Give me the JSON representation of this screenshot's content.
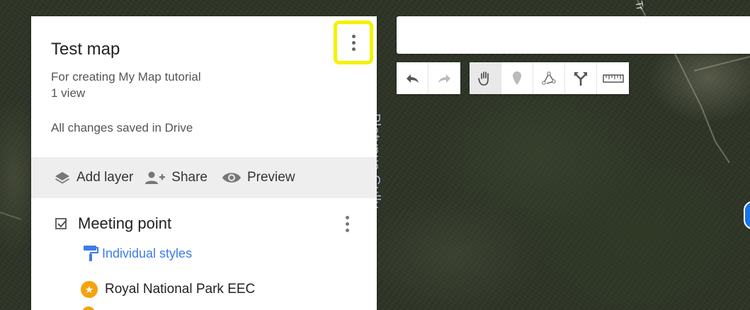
{
  "map": {
    "gully_label": "Platypus Gully",
    "corner_label": "Tr"
  },
  "panel": {
    "title": "Test map",
    "description": "For creating My Map tutorial",
    "views": "1 view",
    "save_status": "All changes saved in Drive",
    "actions": {
      "add_layer": "Add layer",
      "share": "Share",
      "preview": "Preview"
    },
    "layer": {
      "name": "Meeting point",
      "checked": true,
      "style_label": "Individual styles",
      "places": [
        {
          "label": "Royal National Park EEC",
          "icon": "star-marker-icon"
        }
      ]
    }
  },
  "search": {
    "value": ""
  },
  "tools": [
    {
      "name": "undo-icon",
      "active": false
    },
    {
      "name": "redo-icon",
      "active": false
    },
    {
      "name": "hand-icon",
      "active": true
    },
    {
      "name": "add-marker-icon",
      "active": false
    },
    {
      "name": "draw-line-icon",
      "active": false
    },
    {
      "name": "directions-icon",
      "active": false
    },
    {
      "name": "ruler-icon",
      "active": false
    }
  ],
  "colors": {
    "highlight": "#f5f200",
    "link": "#3f7be8",
    "place_marker": "#f4a30f"
  }
}
